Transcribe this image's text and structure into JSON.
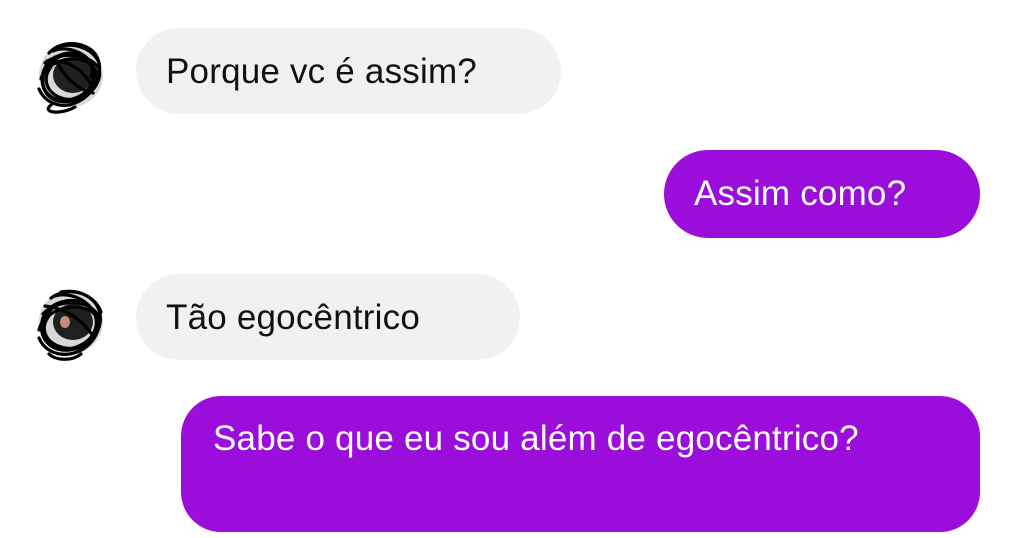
{
  "conversation": {
    "messages": [
      {
        "direction": "incoming",
        "text": "Porque vc é assim?"
      },
      {
        "direction": "outgoing",
        "text": "Assim como?"
      },
      {
        "direction": "incoming",
        "text": "Tão egocêntrico"
      },
      {
        "direction": "outgoing",
        "text": "Sabe o que eu sou além de egocêntrico?"
      }
    ]
  },
  "colors": {
    "incoming_bubble": "#f1f1f3",
    "outgoing_bubble": "#9a0ddb",
    "incoming_text": "#111111",
    "outgoing_text": "#ffffff"
  },
  "icons": {
    "avatar": "avatar-scribbled-out-icon"
  }
}
